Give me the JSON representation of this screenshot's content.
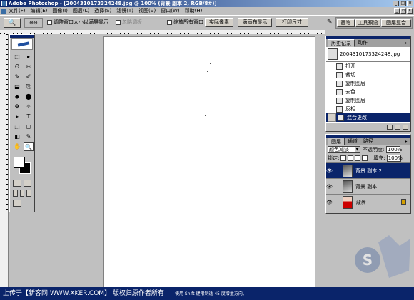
{
  "titlebar": {
    "title": "Adobe Photoshop - [20043101733242​48.jpg @ 100% (背景 副本 2, RGB/8#)]"
  },
  "menu": {
    "items": [
      "文件(F)",
      "编辑(E)",
      "图像(I)",
      "图层(L)",
      "选择(S)",
      "滤镜(T)",
      "视图(V)",
      "窗口(W)",
      "帮助(H)"
    ]
  },
  "options": {
    "tool_icon": "🔍",
    "zoom_icons": "⊕⊖",
    "resize_windows_label": "调整窗口大小以满屏显示",
    "ignore_palettes_label": "忽略调板",
    "zoom_all_label": "缩放所有窗口",
    "actual_pixels_label": "实际像素",
    "fit_screen_label": "满画布显示",
    "print_size_label": "打印尺寸",
    "well_tabs": [
      "画笔",
      "工具预设",
      "图层复合"
    ]
  },
  "toolbox": {
    "tools": [
      "⬚",
      "▸",
      "ʘ",
      "✂",
      "✎",
      "✐",
      "⬓",
      "⎘",
      "◆",
      "⬤",
      "✥",
      "✧",
      "▸",
      "T",
      "⬚",
      "◻",
      "◧",
      "✎",
      "✋",
      "🔍"
    ],
    "active_index": 19
  },
  "history": {
    "tabs": [
      "历史记录",
      "动作"
    ],
    "snapshot_name": "20043101733242​48.jpg",
    "steps": [
      "打开",
      "裁切",
      "复制图层",
      "去色",
      "复制图层",
      "反相",
      "混合更改"
    ],
    "selected_step": 6
  },
  "layers": {
    "tabs": [
      "图层",
      "通道",
      "路径"
    ],
    "blend_mode": "颜色减淡",
    "opacity_label": "不透明度:",
    "opacity_value": "100%",
    "lock_label": "锁定:",
    "fill_label": "填充:",
    "fill_value": "100%",
    "items": [
      {
        "name": "背景 副本 2",
        "selected": true,
        "style": "gray"
      },
      {
        "name": "背景 副本",
        "selected": false,
        "style": "gray"
      },
      {
        "name": "背景",
        "selected": false,
        "style": "portrait",
        "italic": true,
        "locked": true
      }
    ]
  },
  "status": {
    "watermark_text": "上传于【新客网 WWW.XKER.COM】 版权归原作者所有",
    "hint_text": "使用 Shift 键限制适 45 度增量方向。"
  },
  "colors": {
    "title_start": "#0a246a",
    "title_end": "#a6caf0",
    "chrome": "#c0c0c0",
    "selection": "#0a246a"
  }
}
